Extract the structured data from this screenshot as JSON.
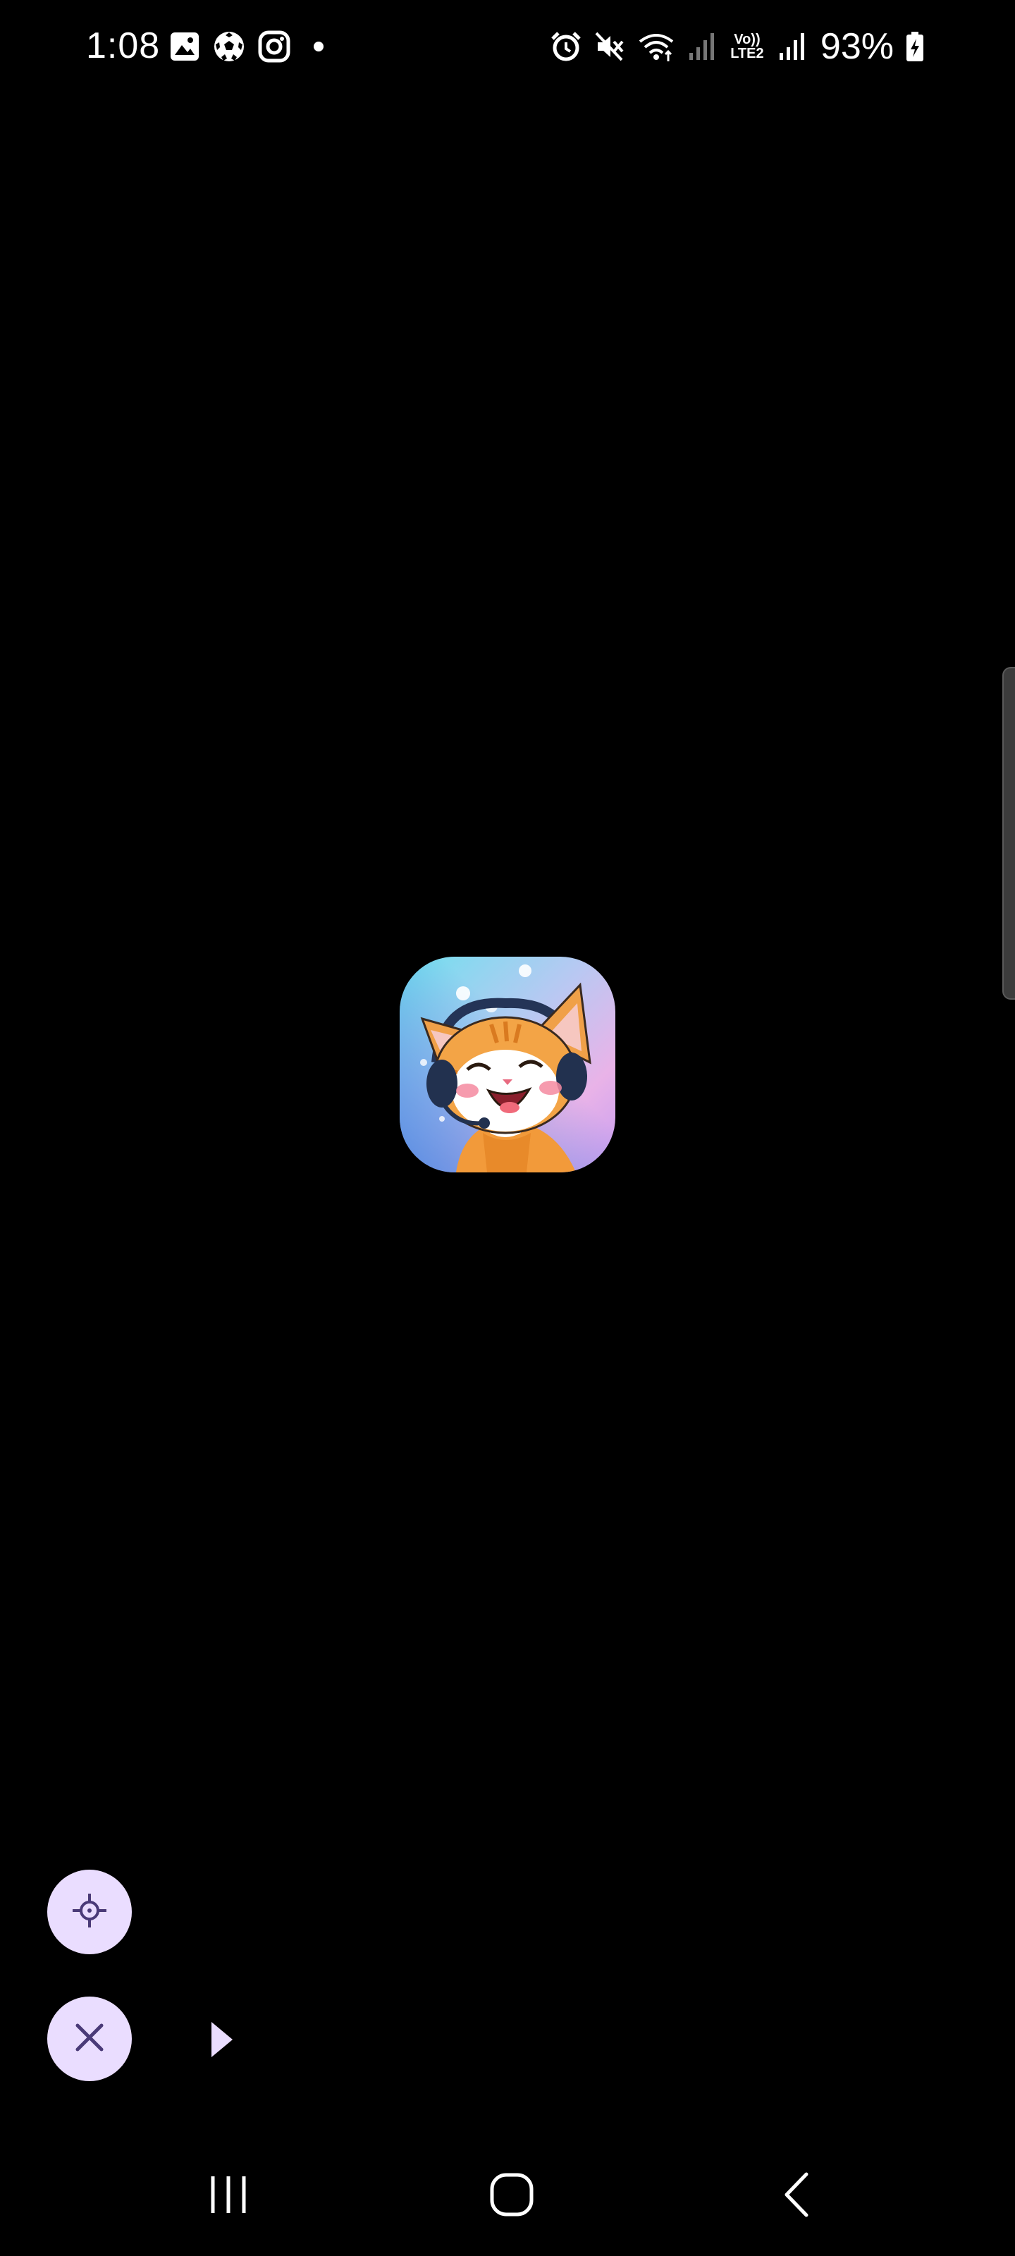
{
  "status_bar": {
    "time": "1:08",
    "left_icons": [
      "gallery-icon",
      "soccer-ball-icon",
      "instagram-icon",
      "notification-dot-icon"
    ],
    "right_icons": [
      "alarm-icon",
      "mute-icon",
      "wifi-icon",
      "signal-icon",
      "signal-icon"
    ],
    "network_label_top": "Vo))",
    "network_label_bottom": "LTE2",
    "battery_percent": "93%"
  },
  "app_icon": {
    "description_icon": "cat-with-headphones-app-icon"
  },
  "floating_controls": {
    "target_button_icon": "crosshair-icon",
    "close_button_icon": "close-icon",
    "expand_arrow_icon": "play-arrow-icon",
    "button_color": "#eaddff",
    "icon_color": "#4a3a78"
  },
  "nav_bar": {
    "recents_icon": "recents-icon",
    "home_icon": "home-icon",
    "back_icon": "back-icon"
  }
}
